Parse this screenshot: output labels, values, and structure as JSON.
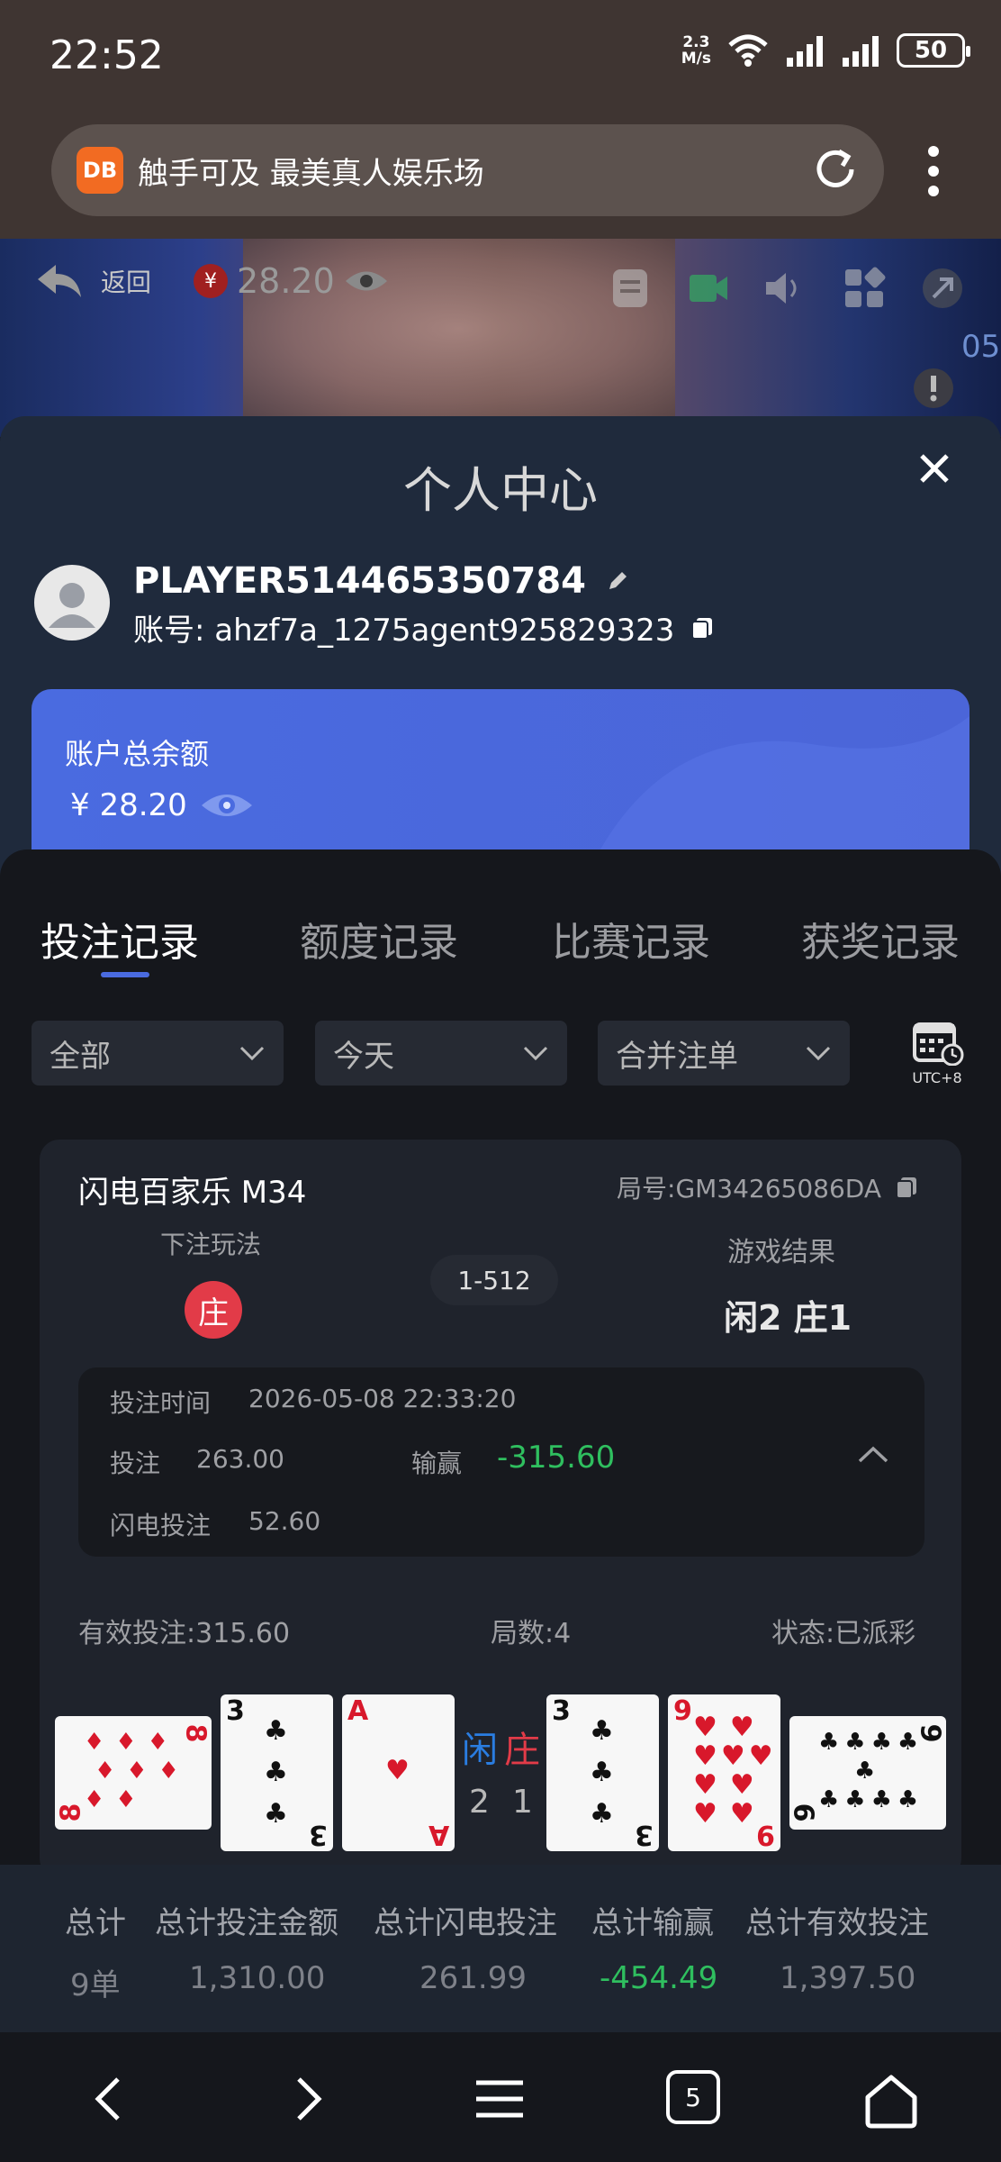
{
  "status_bar": {
    "time": "22:52",
    "net_speed_top": "2.3",
    "net_speed_bottom": "M/s",
    "battery": "50"
  },
  "browser": {
    "logo_text": "DB",
    "title": "触手可及 最美真人娱乐场"
  },
  "video_controls": {
    "back_label": "返回",
    "balance": "28.20",
    "yen_symbol": "¥",
    "overlay_timer": "05"
  },
  "modal": {
    "title": "个人中心",
    "player_name": "PLAYER514465350784",
    "account_label": "账号:",
    "account_value": "ahzf7a_1275agent925829323",
    "balance_label": "账户总余额",
    "balance_value": "¥ 28.20"
  },
  "tabs": [
    {
      "label": "投注记录",
      "active": true
    },
    {
      "label": "额度记录",
      "active": false
    },
    {
      "label": "比赛记录",
      "active": false
    },
    {
      "label": "获奖记录",
      "active": false
    }
  ],
  "filters": {
    "type": "全部",
    "date": "今天",
    "merge": "合并注单",
    "timezone": "UTC+8"
  },
  "record": {
    "game": "闪电百家乐 M34",
    "round_id_label": "局号:",
    "round_id": "GM34265086DA",
    "bet_play_label": "下注玩法",
    "bet_play_value": "庄",
    "round_no": "1-512",
    "result_label": "游戏结果",
    "result_value": "闲2 庄1",
    "bet_time_label": "投注时间",
    "bet_time": "2026-05-08 22:33:20",
    "bet_label": "投注",
    "bet_amount": "263.00",
    "win_loss_label": "输赢",
    "win_loss": "-315.60",
    "lightning_label": "闪电投注",
    "lightning_amount": "52.60",
    "valid_bet": "有效投注:315.60",
    "rounds": "局数:4",
    "status": "状态:已派彩",
    "player_label": "闲",
    "banker_label": "庄",
    "player_score": "2",
    "banker_score": "1",
    "cards": [
      {
        "rank": "8",
        "suit": "♦",
        "side": "player",
        "rotated": true
      },
      {
        "rank": "3",
        "suit": "♣",
        "side": "player",
        "rotated": false
      },
      {
        "rank": "A",
        "suit": "♥",
        "side": "player",
        "rotated": false
      },
      {
        "rank": "3",
        "suit": "♣",
        "side": "banker",
        "rotated": false
      },
      {
        "rank": "9",
        "suit": "♥",
        "side": "banker",
        "rotated": false
      },
      {
        "rank": "9",
        "suit": "♣",
        "side": "banker",
        "rotated": true
      }
    ]
  },
  "totals": {
    "headers": [
      "总计",
      "总计投注金额",
      "总计闪电投注",
      "总计输赢",
      "总计有效投注"
    ],
    "values": [
      "9单",
      "1,310.00",
      "261.99",
      "-454.49",
      "1,397.50"
    ]
  },
  "nav": {
    "tabs_count": "5"
  },
  "colors": {
    "accent": "#4a6be0",
    "loss": "#2fbf5f",
    "banker": "#e23b48",
    "player": "#2a7de1"
  }
}
